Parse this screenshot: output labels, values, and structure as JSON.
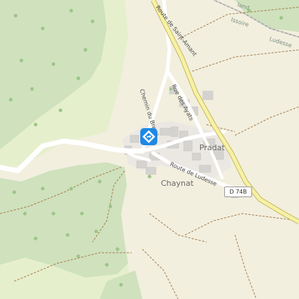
{
  "map": {
    "labels": {
      "route_saint_amant": "Route de Saint-Amant",
      "chemin_du_breuil": "Chemin du Breuil",
      "rue_des_ayats": "Rue des Ayats",
      "route_de_ludesse": "Route de Ludesse",
      "pradat": "Pradat",
      "chaynat": "Chaynat",
      "issoire": "Issoire",
      "ludesse": "Ludesse",
      "land": "land"
    },
    "shields": {
      "d74b": "D 74B"
    },
    "marker": {
      "icon": "diamond-turn-icon",
      "color": "#1e88e5"
    },
    "colors": {
      "forest": "#cfe1bd",
      "meadow": "#e6efcc",
      "background": "#f2efdf",
      "main_road": "#f6f1a6",
      "main_road_casing": "#c7b95d",
      "track": "#a77c48",
      "building": "#d5d3d0",
      "rail": "#9b9b9b"
    }
  }
}
